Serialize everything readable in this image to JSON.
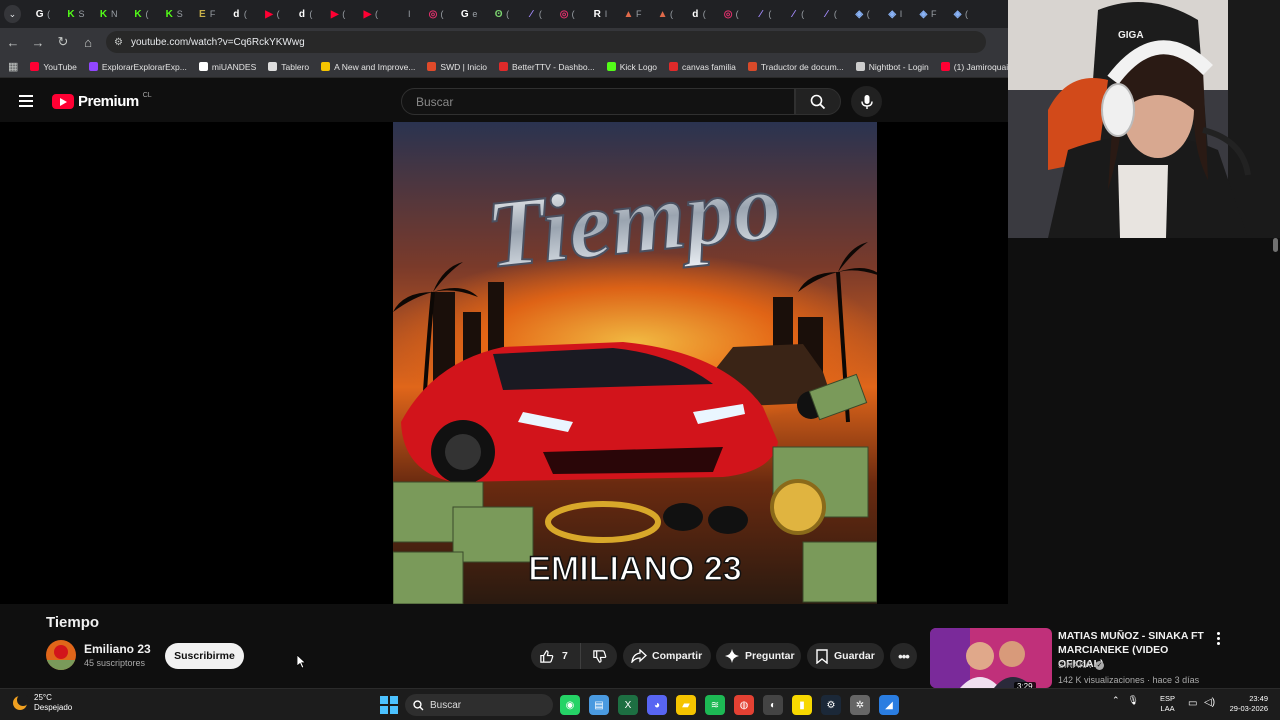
{
  "browser": {
    "url": "youtube.com/watch?v=Cq6RckYKWwg",
    "tabs": [
      {
        "color": "#ffffff",
        "glyph": "G",
        "sep": "("
      },
      {
        "color": "#53fc18",
        "glyph": "K",
        "sep": "S"
      },
      {
        "color": "#53fc18",
        "glyph": "K",
        "sep": "N"
      },
      {
        "color": "#53fc18",
        "glyph": "K",
        "sep": "("
      },
      {
        "color": "#53fc18",
        "glyph": "K",
        "sep": "S"
      },
      {
        "color": "#c8b04a",
        "glyph": "E",
        "sep": "F"
      },
      {
        "color": "#ffffff",
        "glyph": "d",
        "sep": "("
      },
      {
        "color": "#ff0033",
        "glyph": "▶",
        "sep": "("
      },
      {
        "color": "#ffffff",
        "glyph": "d",
        "sep": "("
      },
      {
        "color": "#ff0033",
        "glyph": "▶",
        "sep": "("
      },
      {
        "color": "#ff0033",
        "glyph": "▶",
        "sep": "("
      },
      {
        "color": "#0a0a3a",
        "glyph": "",
        "sep": "I"
      },
      {
        "color": "#e1306c",
        "glyph": "◎",
        "sep": "("
      },
      {
        "color": "#ffffff",
        "glyph": "G",
        "sep": "e"
      },
      {
        "color": "#7bd36f",
        "glyph": "ʘ",
        "sep": "("
      },
      {
        "color": "#a58cff",
        "glyph": "∕",
        "sep": "("
      },
      {
        "color": "#e1306c",
        "glyph": "◎",
        "sep": "("
      },
      {
        "color": "#ffffff",
        "glyph": "R",
        "sep": "I"
      },
      {
        "color": "#e06a4a",
        "glyph": "▲",
        "sep": "F"
      },
      {
        "color": "#e06a4a",
        "glyph": "▲",
        "sep": "("
      },
      {
        "color": "#ffffff",
        "glyph": "d",
        "sep": "("
      },
      {
        "color": "#e1306c",
        "glyph": "◎",
        "sep": "("
      },
      {
        "color": "#a58cff",
        "glyph": "∕",
        "sep": "("
      },
      {
        "color": "#a58cff",
        "glyph": "∕",
        "sep": "("
      },
      {
        "color": "#a58cff",
        "glyph": "∕",
        "sep": "("
      },
      {
        "color": "#8ab4f8",
        "glyph": "◈",
        "sep": "("
      },
      {
        "color": "#8ab4f8",
        "glyph": "◈",
        "sep": "I"
      },
      {
        "color": "#8ab4f8",
        "glyph": "◈",
        "sep": "F"
      },
      {
        "color": "#8ab4f8",
        "glyph": "◈",
        "sep": "("
      },
      {
        "color": "#c8e04a",
        "glyph": "",
        "sep": ""
      }
    ],
    "bookmarks": [
      {
        "label": "YouTube",
        "color": "#ff0033"
      },
      {
        "label": "ExplorarExplorarExp...",
        "color": "#9146ff"
      },
      {
        "label": "miUANDES",
        "color": "#ffffff"
      },
      {
        "label": "Tablero",
        "color": "#dddddd"
      },
      {
        "label": "A New and Improve...",
        "color": "#f5c400"
      },
      {
        "label": "SWD | Inicio",
        "color": "#e04a2a"
      },
      {
        "label": "BetterTTV - Dashbo...",
        "color": "#e02a2a"
      },
      {
        "label": "Kick Logo",
        "color": "#53fc18"
      },
      {
        "label": "canvas familia",
        "color": "#e02a2a"
      },
      {
        "label": "Traductor de docum...",
        "color": "#d84a2a"
      },
      {
        "label": "Nightbot - Login",
        "color": "#cccccc"
      },
      {
        "label": "(1) Jamiroquai - Can...",
        "color": "#ff0033"
      }
    ]
  },
  "youtube": {
    "logo_text": "Premium",
    "country_code": "CL",
    "search_placeholder": "Buscar"
  },
  "video": {
    "thumbnail_title_art": "Tiempo",
    "thumbnail_artist_art": "EMILIANO 23",
    "title": "Tiempo",
    "channel": "Emiliano 23",
    "subscribers": "45 suscriptores",
    "subscribe_label": "Suscribirme",
    "likes": "7",
    "share_label": "Compartir",
    "ask_label": "Preguntar",
    "save_label": "Guardar"
  },
  "recommendation": {
    "title": "MATIAS MUÑOZ - SINAKA FT MARCIANEKE (VIDEO OFICIAL)",
    "channel": "SINAKA",
    "meta": "142 K visualizaciones · hace 3 días",
    "duration": "3:29"
  },
  "taskbar": {
    "temperature": "25°C",
    "weather": "Despejado",
    "search_label": "Buscar",
    "lang_top": "ESP",
    "lang_bottom": "LAA",
    "time": "23:49",
    "date": "29-03-2026",
    "apps": [
      {
        "name": "whatsapp",
        "color": "#25d366",
        "glyph": "◉"
      },
      {
        "name": "notepad",
        "color": "#4a9ae0",
        "glyph": "▤"
      },
      {
        "name": "excel",
        "color": "#1d6f42",
        "glyph": "X"
      },
      {
        "name": "discord",
        "color": "#5865f2",
        "glyph": "◕"
      },
      {
        "name": "files",
        "color": "#f5c400",
        "glyph": "▰"
      },
      {
        "name": "spotify",
        "color": "#1db954",
        "glyph": "≋"
      },
      {
        "name": "chrome",
        "color": "#e34133",
        "glyph": "◍"
      },
      {
        "name": "obs",
        "color": "#444444",
        "glyph": "◐"
      },
      {
        "name": "sticky-notes",
        "color": "#f7d800",
        "glyph": "▮"
      },
      {
        "name": "steam",
        "color": "#1b2838",
        "glyph": "⚙"
      },
      {
        "name": "settings",
        "color": "#666666",
        "glyph": "✲"
      },
      {
        "name": "app-blue",
        "color": "#2a7de1",
        "glyph": "◢"
      }
    ]
  }
}
